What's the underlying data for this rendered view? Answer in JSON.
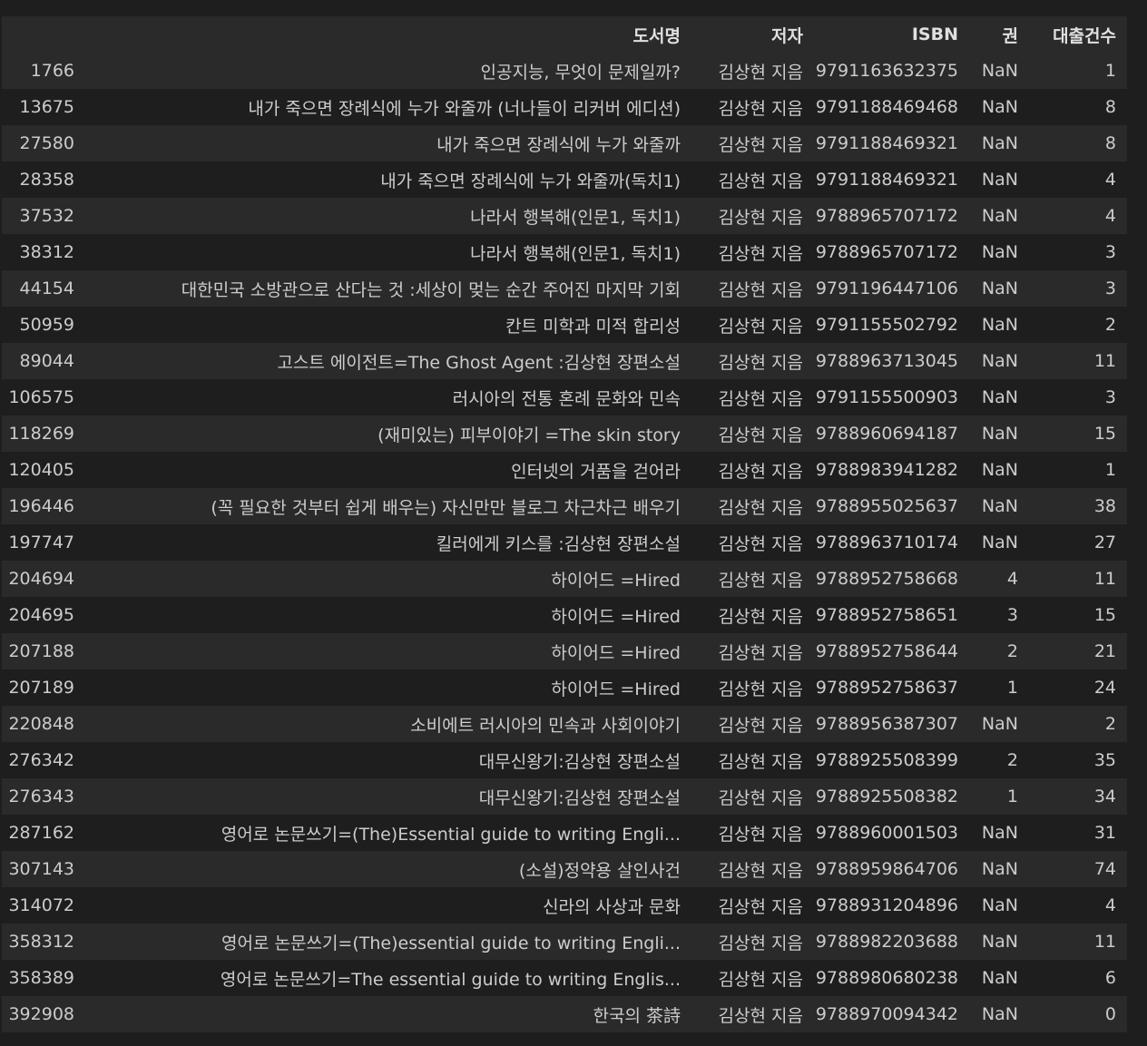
{
  "table": {
    "columns": [
      "",
      "도서명",
      "저자",
      "ISBN",
      "권",
      "대출건수"
    ],
    "rows": [
      [
        "1766",
        "인공지능, 무엇이 문제일까?",
        "김상현 지음",
        "9791163632375",
        "NaN",
        "1"
      ],
      [
        "13675",
        "내가 죽으면 장례식에 누가 와줄까 (너나들이 리커버 에디션)",
        "김상현 지음",
        "9791188469468",
        "NaN",
        "8"
      ],
      [
        "27580",
        "내가 죽으면 장례식에 누가 와줄까",
        "김상현 지음",
        "9791188469321",
        "NaN",
        "8"
      ],
      [
        "28358",
        "내가 죽으면 장례식에 누가 와줄까(독치1)",
        "김상현 지음",
        "9791188469321",
        "NaN",
        "4"
      ],
      [
        "37532",
        "나라서 행복해(인문1, 독치1)",
        "김상현 지음",
        "9788965707172",
        "NaN",
        "4"
      ],
      [
        "38312",
        "나라서 행복해(인문1, 독치1)",
        "김상현 지음",
        "9788965707172",
        "NaN",
        "3"
      ],
      [
        "44154",
        "대한민국 소방관으로 산다는 것 :세상이 멎는 순간 주어진 마지막 기회",
        "김상현 지음",
        "9791196447106",
        "NaN",
        "3"
      ],
      [
        "50959",
        "칸트 미학과 미적 합리성",
        "김상현 지음",
        "9791155502792",
        "NaN",
        "2"
      ],
      [
        "89044",
        "고스트 에이전트=The Ghost Agent :김상현 장편소설",
        "김상현 지음",
        "9788963713045",
        "NaN",
        "11"
      ],
      [
        "106575",
        "러시아의 전통 혼례 문화와 민속",
        "김상현 지음",
        "9791155500903",
        "NaN",
        "3"
      ],
      [
        "118269",
        "(재미있는) 피부이야기 =The skin story",
        "김상현 지음",
        "9788960694187",
        "NaN",
        "15"
      ],
      [
        "120405",
        "인터넷의 거품을 걷어라",
        "김상현 지음",
        "9788983941282",
        "NaN",
        "1"
      ],
      [
        "196446",
        "(꼭 필요한 것부터 쉽게 배우는) 자신만만 블로그 차근차근 배우기",
        "김상현 지음",
        "9788955025637",
        "NaN",
        "38"
      ],
      [
        "197747",
        "킬러에게 키스를 :김상현 장편소설",
        "김상현 지음",
        "9788963710174",
        "NaN",
        "27"
      ],
      [
        "204694",
        "하이어드 =Hired",
        "김상현 지음",
        "9788952758668",
        "4",
        "11"
      ],
      [
        "204695",
        "하이어드 =Hired",
        "김상현 지음",
        "9788952758651",
        "3",
        "15"
      ],
      [
        "207188",
        "하이어드 =Hired",
        "김상현 지음",
        "9788952758644",
        "2",
        "21"
      ],
      [
        "207189",
        "하이어드 =Hired",
        "김상현 지음",
        "9788952758637",
        "1",
        "24"
      ],
      [
        "220848",
        "소비에트 러시아의 민속과 사회이야기",
        "김상현 지음",
        "9788956387307",
        "NaN",
        "2"
      ],
      [
        "276342",
        "대무신왕기:김상현 장편소설",
        "김상현 지음",
        "9788925508399",
        "2",
        "35"
      ],
      [
        "276343",
        "대무신왕기:김상현 장편소설",
        "김상현 지음",
        "9788925508382",
        "1",
        "34"
      ],
      [
        "287162",
        "영어로 논문쓰기=(The)Essential guide to writing Engli...",
        "김상현 지음",
        "9788960001503",
        "NaN",
        "31"
      ],
      [
        "307143",
        "(소설)정약용 살인사건",
        "김상현 지음",
        "9788959864706",
        "NaN",
        "74"
      ],
      [
        "314072",
        "신라의 사상과 문화",
        "김상현 지음",
        "9788931204896",
        "NaN",
        "4"
      ],
      [
        "358312",
        "영어로 논문쓰기=(The)essential guide to writing Engli...",
        "김상현 지음",
        "9788982203688",
        "NaN",
        "11"
      ],
      [
        "358389",
        "영어로 논문쓰기=The essential guide to writing Englis...",
        "김상현 지음",
        "9788980680238",
        "NaN",
        "6"
      ],
      [
        "392908",
        "한국의 茶詩",
        "김상현 지음",
        "9788970094342",
        "NaN",
        "0"
      ]
    ]
  }
}
